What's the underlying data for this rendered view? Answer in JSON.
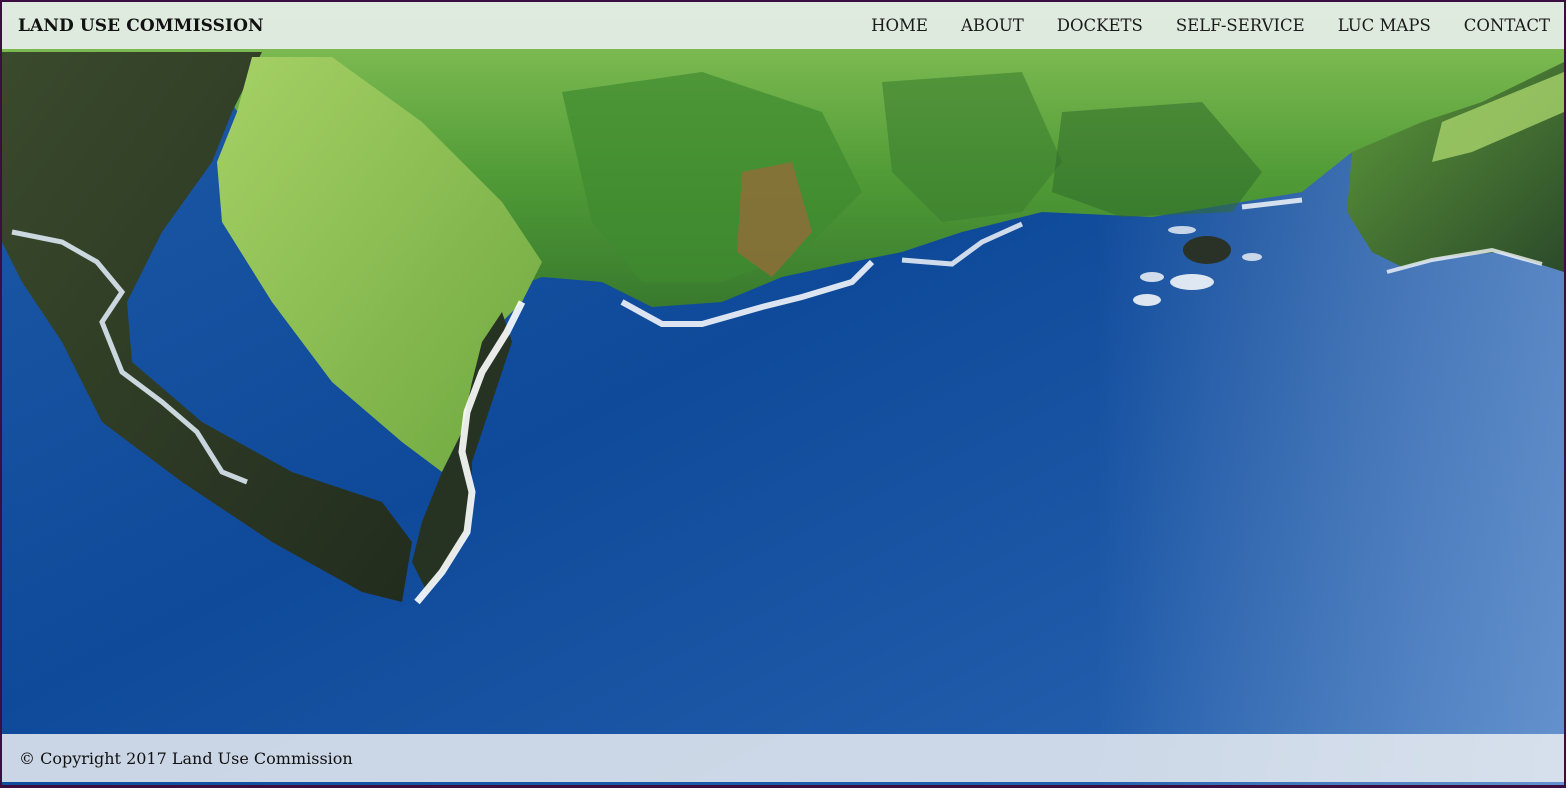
{
  "header": {
    "brand": "LAND USE COMMISSION",
    "nav": [
      {
        "label": "HOME"
      },
      {
        "label": "ABOUT"
      },
      {
        "label": "DOCKETS"
      },
      {
        "label": "SELF-SERVICE"
      },
      {
        "label": "LUC MAPS"
      },
      {
        "label": "CONTACT"
      }
    ]
  },
  "hero": {
    "image": "aerial-coastline-photo",
    "colors": {
      "ocean": "#1a4f9c",
      "cliff_green": "#6fae3a",
      "cliff_shadow": "#2b3a24"
    }
  },
  "footer": {
    "copyright": "© Copyright 2017 Land Use Commission"
  },
  "colors": {
    "bar_background": "#eceff2",
    "text": "#111111",
    "page_border": "#3a0f3f"
  }
}
